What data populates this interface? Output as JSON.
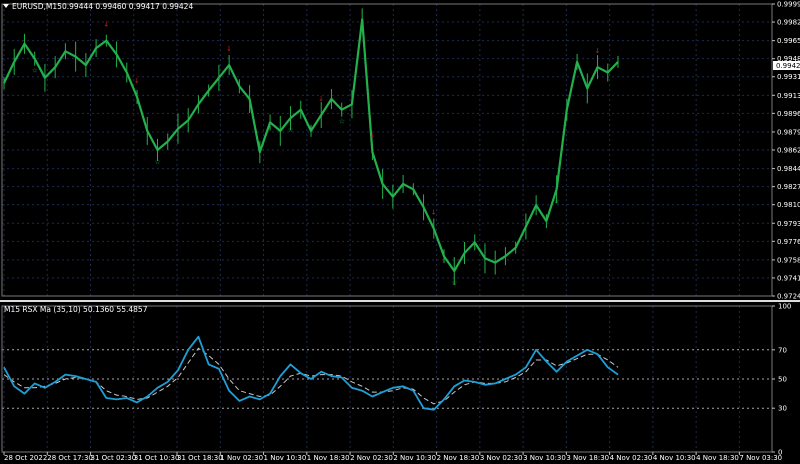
{
  "main_header": {
    "symbol": "EURUSD,M15",
    "ohlc": "0.99444 0.99460 0.99417 0.99424"
  },
  "indicator_header": {
    "text": "M15  RSX Ma (35,10) 50.1360 55.4857"
  },
  "current_price_label": "0.99424",
  "colors": {
    "background": "#000000",
    "candles": "#22b14c",
    "grid": "#1e2a50",
    "axis": "#c0c0c0",
    "fractal_up": "#22b14c",
    "fractal_down": "#d02020",
    "rsx_line": "#1e9fd8",
    "rsx_ma": "#c8c8c8"
  },
  "chart_data": [
    {
      "type": "line",
      "name": "price",
      "ylim": [
        0.97245,
        0.99995
      ],
      "ytick_labels": [
        "0.99995",
        "0.99825",
        "0.99650",
        "0.99480",
        "0.99310",
        "0.99135",
        "0.98965",
        "0.98790",
        "0.98620",
        "0.98445",
        "0.98275",
        "0.98105",
        "0.97930",
        "0.97760",
        "0.97585",
        "0.97415",
        "0.97245"
      ],
      "xtick_labels": [
        "28 Oct 2022",
        "28 Oct 17:30",
        "31 Oct 02:30",
        "31 Oct 10:30",
        "31 Oct 18:30",
        "1 Nov 02:30",
        "1 Nov 10:30",
        "1 Nov 18:30",
        "2 Nov 02:30",
        "2 Nov 10:30",
        "2 Nov 18:30",
        "3 Nov 02:30",
        "3 Nov 10:30",
        "3 Nov 18:30",
        "4 Nov 02:30",
        "4 Nov 10:30",
        "4 Nov 18:30",
        "7 Nov 03:30"
      ],
      "values": [
        0.9925,
        0.9945,
        0.9962,
        0.9948,
        0.993,
        0.994,
        0.9955,
        0.995,
        0.9942,
        0.9958,
        0.9965,
        0.9952,
        0.9935,
        0.9912,
        0.988,
        0.9862,
        0.987,
        0.9882,
        0.989,
        0.9905,
        0.9918,
        0.993,
        0.9942,
        0.9922,
        0.991,
        0.986,
        0.9888,
        0.988,
        0.9892,
        0.99,
        0.988,
        0.9895,
        0.991,
        0.99,
        0.9905,
        0.9985,
        0.986,
        0.983,
        0.9818,
        0.983,
        0.9825,
        0.9808,
        0.9788,
        0.9762,
        0.9748,
        0.9765,
        0.9775,
        0.976,
        0.9756,
        0.9762,
        0.977,
        0.979,
        0.981,
        0.9795,
        0.9825,
        0.99,
        0.9945,
        0.992,
        0.994,
        0.9935,
        0.9945
      ]
    },
    {
      "type": "line",
      "name": "RSX Ma (35,10)",
      "ylim": [
        0,
        100
      ],
      "ytick_labels": [
        "100",
        "70",
        "50",
        "30",
        "0"
      ],
      "levels": [
        70,
        50,
        30
      ],
      "series": [
        {
          "name": "RSX",
          "values": [
            58,
            45,
            40,
            47,
            44,
            48,
            53,
            52,
            50,
            48,
            37,
            36,
            37,
            34,
            38,
            44,
            48,
            56,
            70,
            79,
            60,
            57,
            42,
            35,
            38,
            36,
            40,
            52,
            60,
            54,
            50,
            55,
            52,
            51,
            44,
            42,
            38,
            41,
            44,
            45,
            42,
            30,
            29,
            36,
            45,
            49,
            48,
            46,
            47,
            50,
            53,
            58,
            70,
            62,
            55,
            62,
            66,
            70,
            67,
            58,
            53
          ]
        },
        {
          "name": "Ma",
          "values": [
            53,
            48,
            44,
            44,
            45,
            47,
            50,
            51,
            50,
            48,
            42,
            39,
            38,
            36,
            37,
            41,
            45,
            51,
            61,
            71,
            66,
            60,
            50,
            42,
            40,
            38,
            39,
            45,
            52,
            54,
            52,
            53,
            53,
            52,
            48,
            45,
            41,
            41,
            42,
            44,
            43,
            37,
            33,
            35,
            41,
            46,
            48,
            47,
            47,
            48,
            51,
            55,
            63,
            63,
            59,
            61,
            64,
            67,
            67,
            63,
            58
          ]
        }
      ]
    }
  ]
}
